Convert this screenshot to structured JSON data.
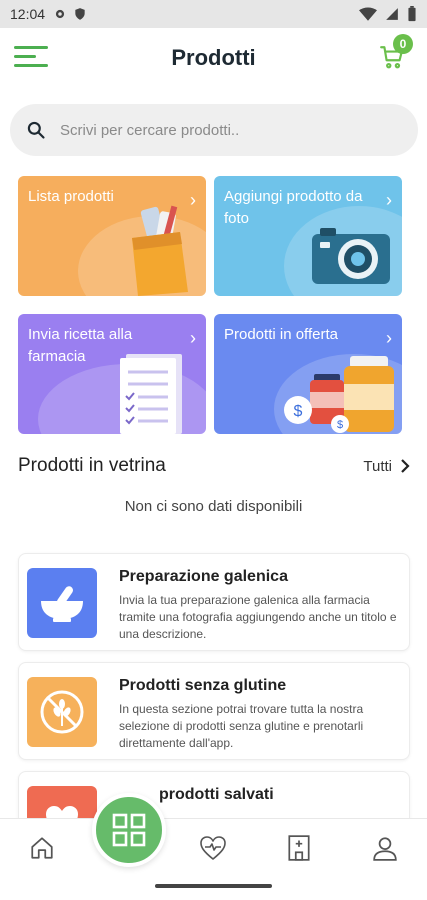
{
  "status_bar": {
    "time": "12:04"
  },
  "app_bar": {
    "title": "Prodotti",
    "cart_count": "0"
  },
  "search": {
    "placeholder": "Scrivi per cercare prodotti.."
  },
  "tiles": [
    {
      "label": "Lista prodotti",
      "icon": "shopping-bag-icon",
      "color": "#f6ae5d"
    },
    {
      "label": "Aggiungi prodotto da foto",
      "icon": "camera-icon",
      "color": "#6fc3ea"
    },
    {
      "label": "Invia ricetta alla farmacia",
      "icon": "prescription-icon",
      "color": "#9a7ff0"
    },
    {
      "label": "Prodotti in offerta",
      "icon": "medicine-bottles-icon",
      "color": "#6a8af0"
    }
  ],
  "showcase": {
    "title": "Prodotti in vetrina",
    "all_label": "Tutti",
    "empty_text": "Non ci sono dati disponibili"
  },
  "cards": [
    {
      "title": "Preparazione galenica",
      "description": "Invia la tua preparazione galenica alla farmacia tramite una fotografia aggiungendo anche un titolo e una descrizione.",
      "icon": "mortar-pestle-icon",
      "color": "#5b7ff0"
    },
    {
      "title": "Prodotti senza glutine",
      "description": "In questa sezione potrai trovare tutta la nostra selezione di prodotti senza glutine e prenotarli direttamente dall'app.",
      "icon": "gluten-free-icon",
      "color": "#f6b15b"
    },
    {
      "title": "prodotti salvati",
      "icon": "heart-icon",
      "color": "#ef6b52"
    }
  ],
  "bottom_nav": [
    {
      "name": "home",
      "icon": "home-icon"
    },
    {
      "name": "categories",
      "icon": "grid-icon"
    },
    {
      "name": "health",
      "icon": "heart-pulse-icon"
    },
    {
      "name": "pharmacy",
      "icon": "pharmacy-building-icon"
    },
    {
      "name": "profile",
      "icon": "user-icon"
    }
  ]
}
